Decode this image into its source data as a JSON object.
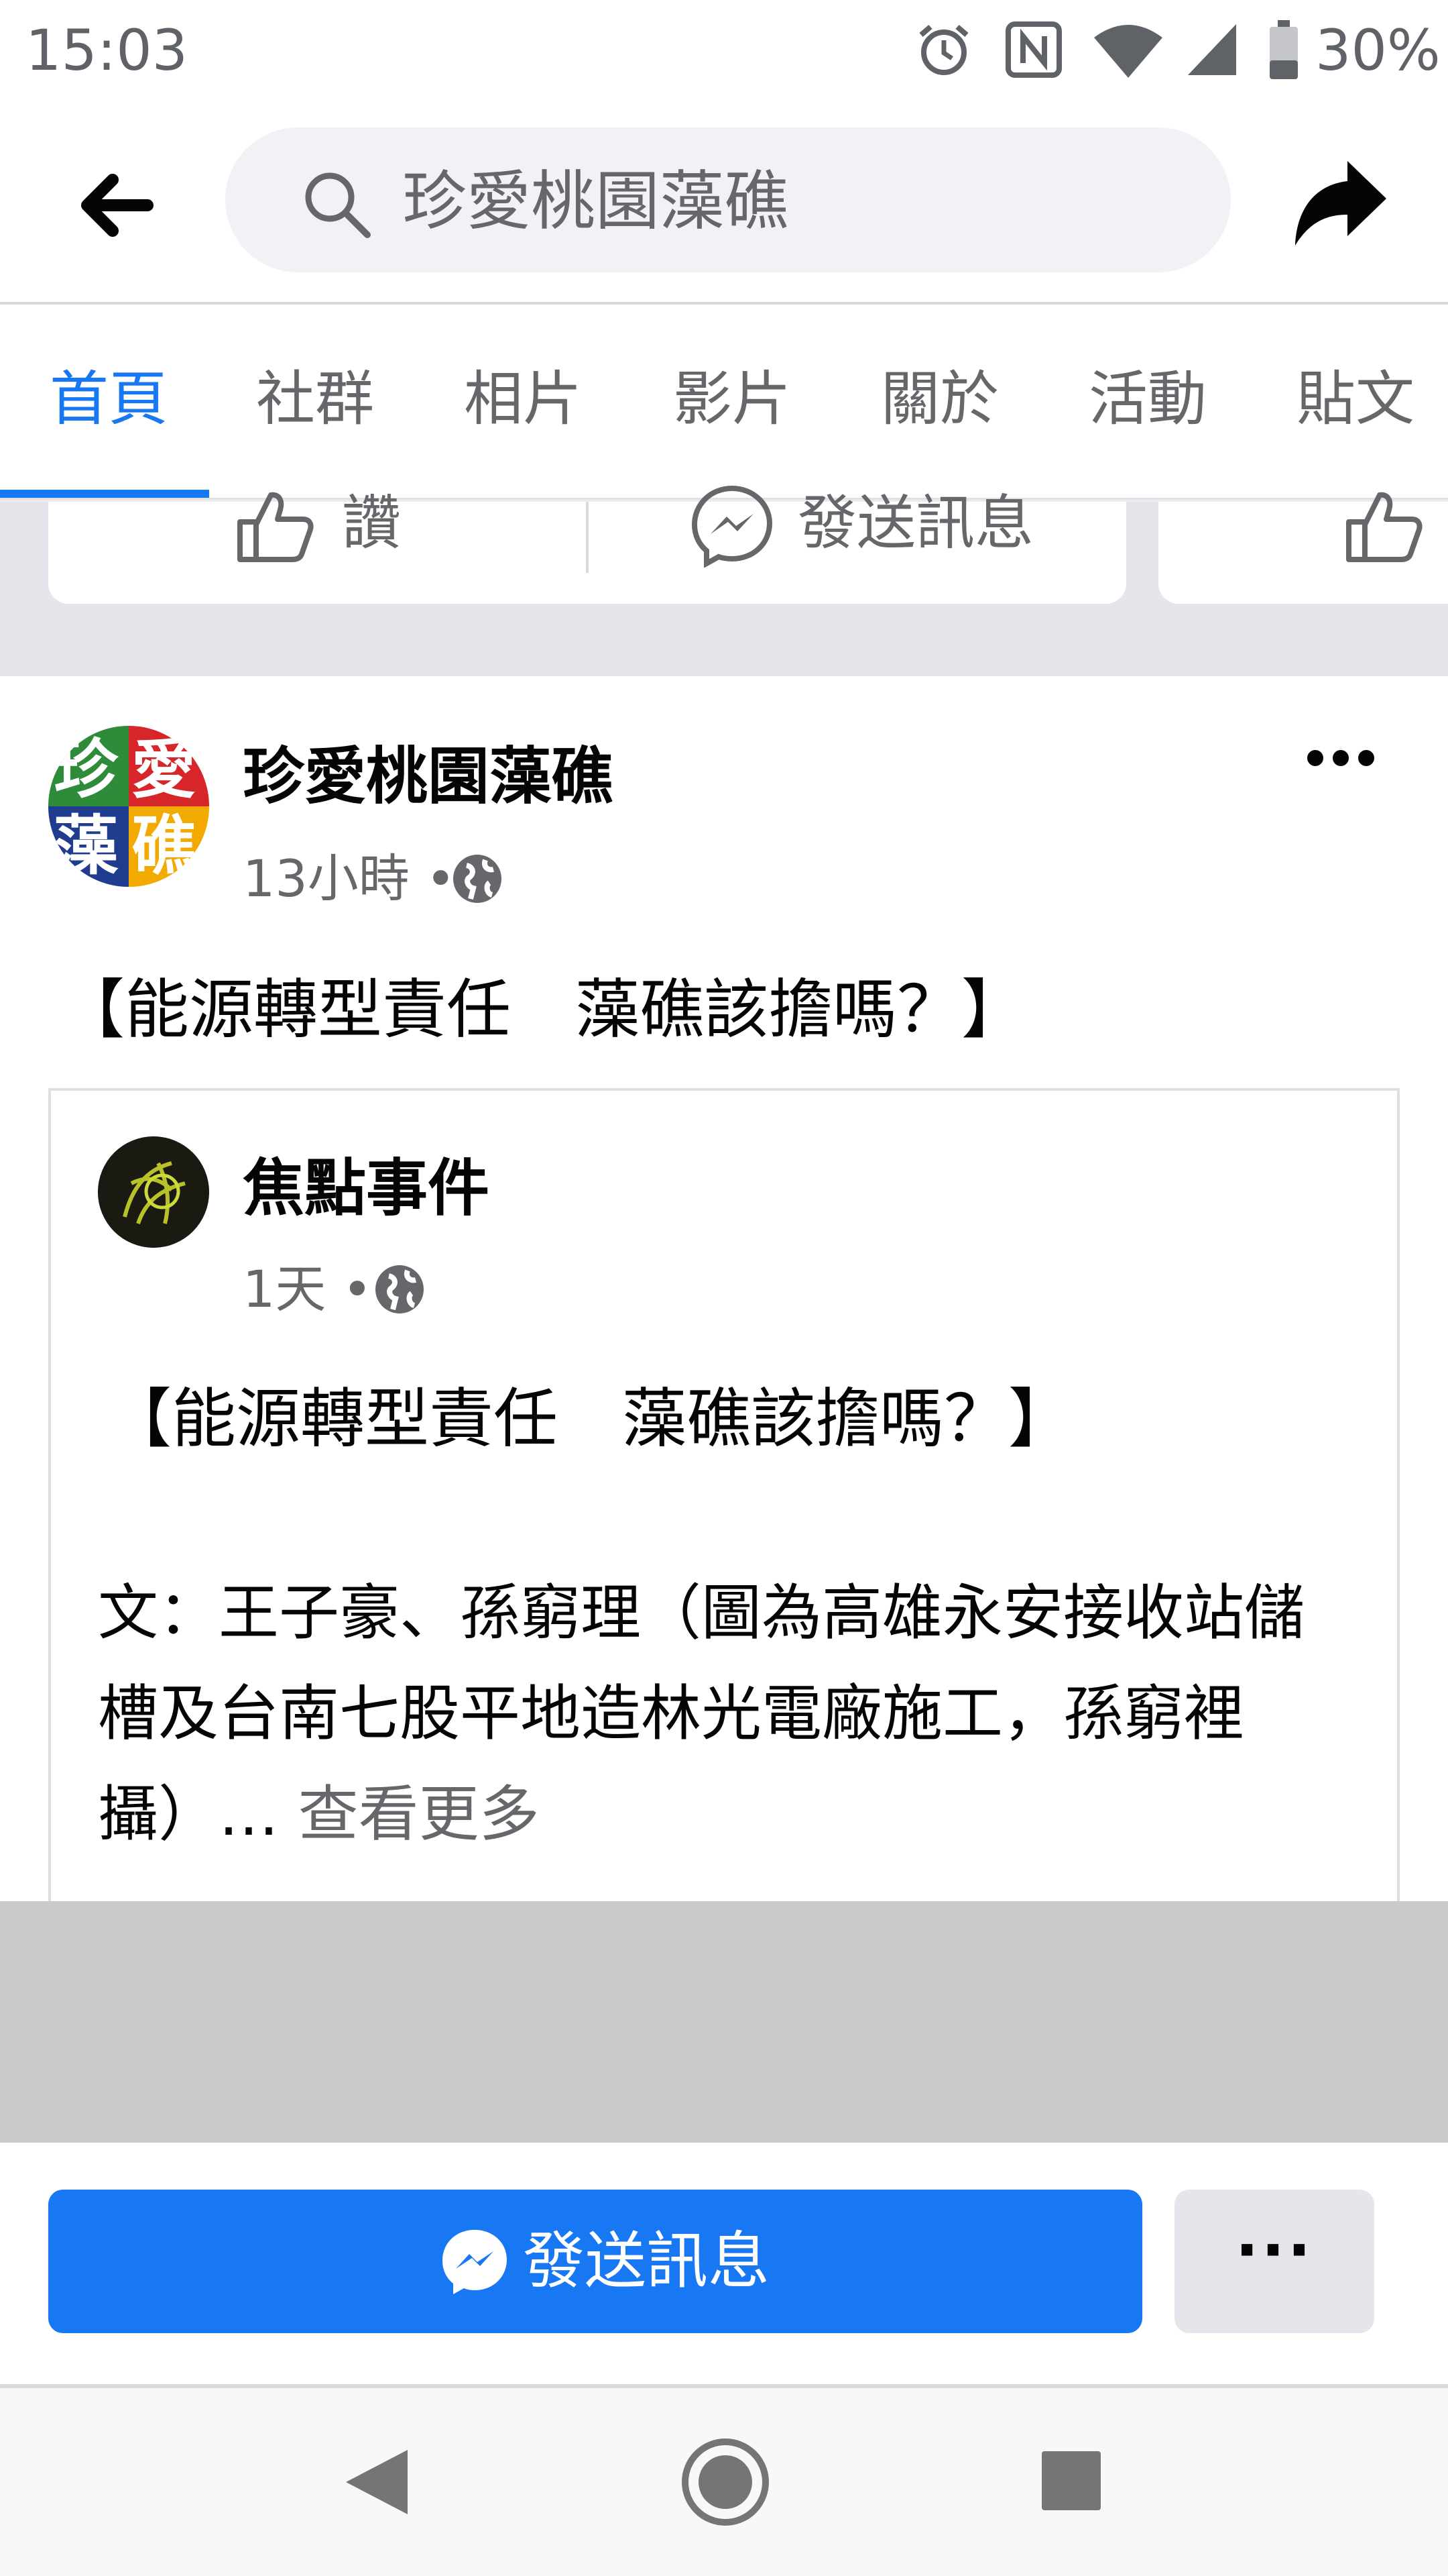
{
  "status_bar": {
    "time": "15:03",
    "battery_percent": "30%",
    "icons": [
      "alarm-icon",
      "nfc-icon",
      "wifi-icon",
      "cellular-signal-icon",
      "battery-icon"
    ]
  },
  "header": {
    "back_icon": "arrow-left-icon",
    "search_text": "珍愛桃園藻礁",
    "share_icon": "share-arrow-icon"
  },
  "tabs": [
    {
      "label": "首頁",
      "active": true
    },
    {
      "label": "社群",
      "active": false
    },
    {
      "label": "相片",
      "active": false
    },
    {
      "label": "影片",
      "active": false
    },
    {
      "label": "關於",
      "active": false
    },
    {
      "label": "活動",
      "active": false
    },
    {
      "label": "貼文",
      "active": false
    }
  ],
  "actions": {
    "like_label": "讚",
    "message_label": "發送訊息"
  },
  "post": {
    "page_name": "珍愛桃園藻礁",
    "avatar_chars": [
      "珍",
      "愛",
      "藻",
      "礁"
    ],
    "time": "13小時",
    "separator": "•",
    "text": "【能源轉型責任　藻礁該擔嗎？】",
    "shared": {
      "page_name": "焦點事件",
      "time": "1天",
      "separator": "•",
      "title": "【能源轉型責任　藻礁該擔嗎？】",
      "body": "文：王子豪、孫窮理（圖為高雄永安接收站儲槽及台南七股平地造林光電廠施工，孫窮裡攝）",
      "ellipsis": "…",
      "see_more": "查看更多"
    }
  },
  "bottom_bar": {
    "send_message_label": "發送訊息",
    "more_label": "···"
  },
  "colors": {
    "accent": "#1877f2",
    "secondary_text": "#65676b",
    "gray_background": "#e4e6eb"
  }
}
